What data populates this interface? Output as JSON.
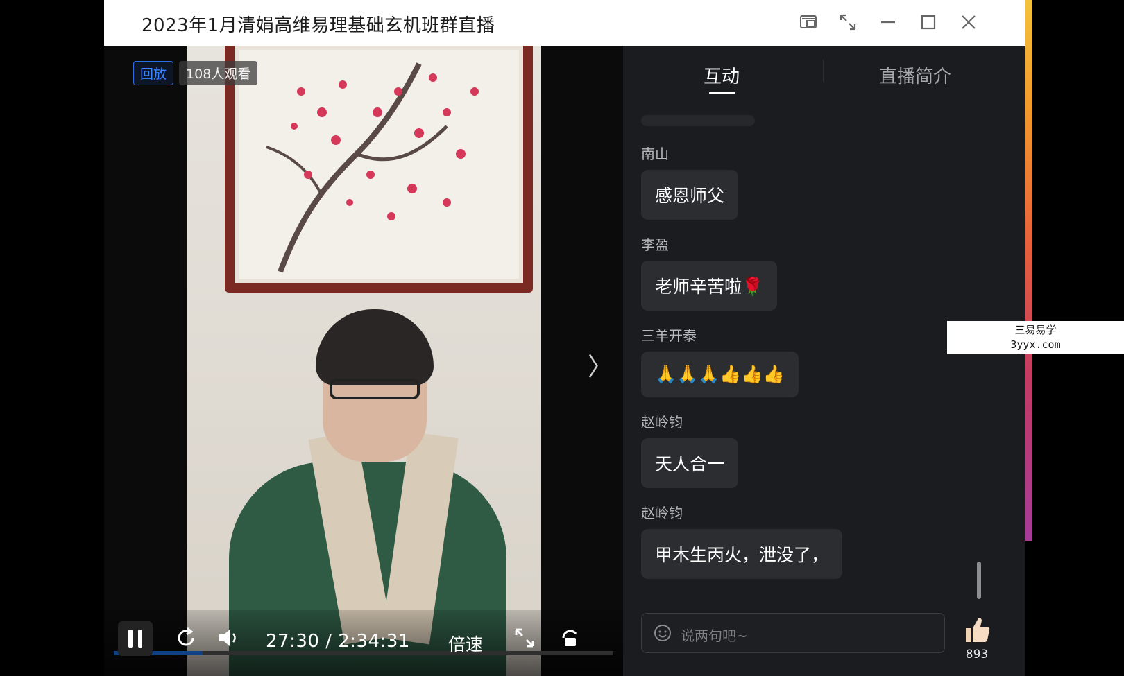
{
  "window": {
    "title": "2023年1月清娟高维易理基础玄机班群直播"
  },
  "video": {
    "replay_badge": "回放",
    "viewers": "108人观看",
    "progress_fraction": 0.178,
    "time_display": "27:30 / 2:34:31",
    "speed_label": "倍速",
    "accent_color": "#1e7bff"
  },
  "chat": {
    "tabs": [
      {
        "label": "互动",
        "active": true
      },
      {
        "label": "直播简介",
        "active": false
      }
    ],
    "messages": [
      {
        "user": "南山",
        "text": "感恩师父"
      },
      {
        "user": "李盈",
        "text": "老师辛苦啦🌹"
      },
      {
        "user": "三羊开泰",
        "text": "🙏🙏🙏👍👍👍"
      },
      {
        "user": "赵岭钧",
        "text": "天人合一"
      },
      {
        "user": "赵岭钧",
        "text": "甲木生丙火，泄没了，"
      }
    ],
    "input_placeholder": "说两句吧~",
    "like_count": "893"
  },
  "watermark": {
    "line1": "三易易学",
    "line2": "3yyx.com"
  },
  "icons": [
    "pip-icon",
    "fullscreen-icon",
    "minimize-icon",
    "maximize-icon",
    "close-icon",
    "pause-icon",
    "replay-icon",
    "volume-icon",
    "expand-icon",
    "rotate-icon",
    "chevron-right-icon",
    "emoji-icon",
    "thumbs-up-icon"
  ]
}
